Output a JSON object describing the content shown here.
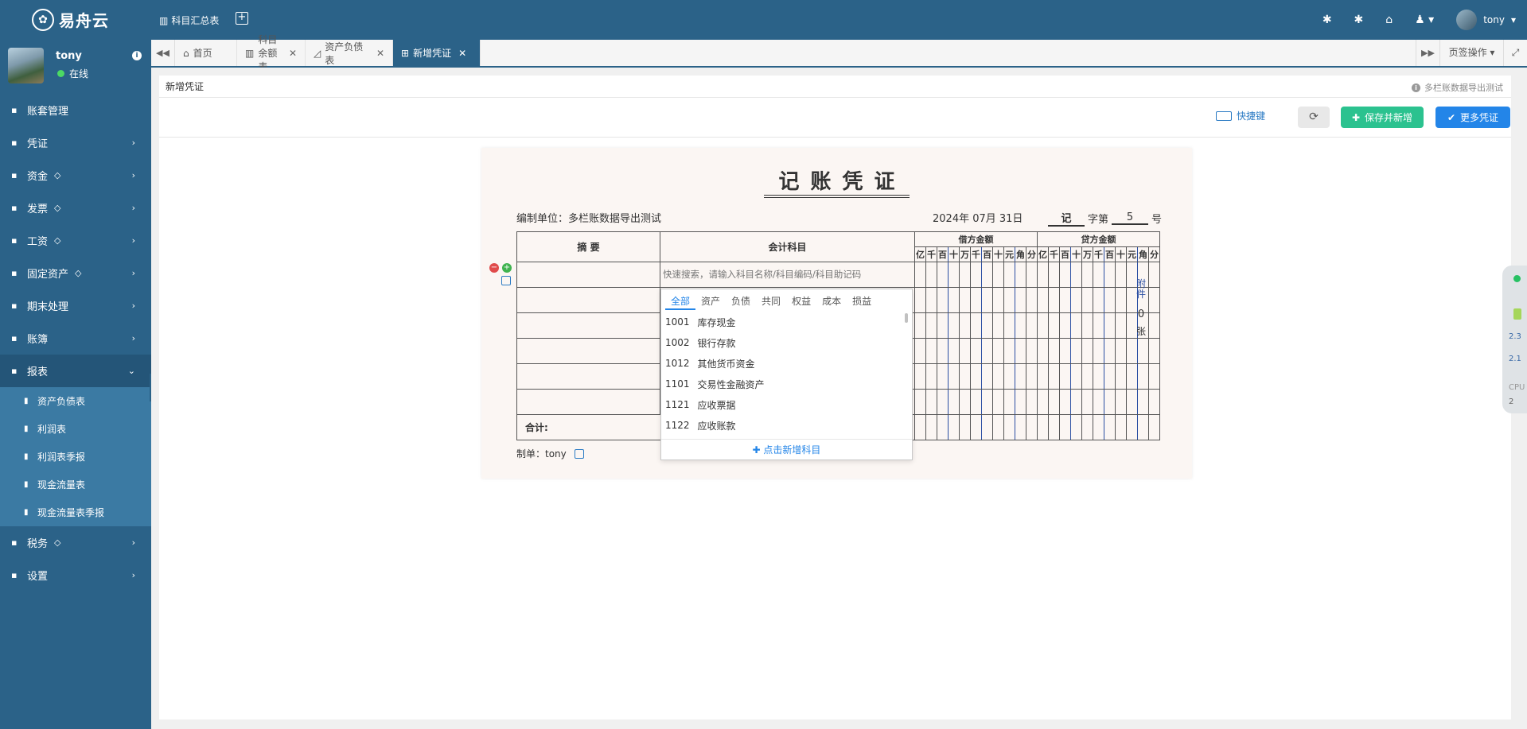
{
  "app": {
    "logo_text": "易舟云",
    "top_link": "科目汇总表",
    "user": "tony"
  },
  "profile": {
    "name": "tony",
    "status": "在线"
  },
  "sidebar": {
    "items": [
      {
        "label": "账套管理",
        "icon": "book-icon",
        "gem": false,
        "arrow": false
      },
      {
        "label": "凭证",
        "icon": "voucher-icon",
        "gem": false,
        "arrow": true
      },
      {
        "label": "资金",
        "icon": "money-icon",
        "gem": true,
        "arrow": true
      },
      {
        "label": "发票",
        "icon": "invoice-icon",
        "gem": true,
        "arrow": true
      },
      {
        "label": "工资",
        "icon": "salary-icon",
        "gem": true,
        "arrow": true
      },
      {
        "label": "固定资产",
        "icon": "asset-icon",
        "gem": true,
        "arrow": true
      },
      {
        "label": "期末处理",
        "icon": "calendar-icon",
        "gem": false,
        "arrow": true
      },
      {
        "label": "账簿",
        "icon": "ledger-icon",
        "gem": false,
        "arrow": true
      },
      {
        "label": "报表",
        "icon": "chart-icon",
        "gem": false,
        "arrow": true,
        "active": true
      },
      {
        "label": "税务",
        "icon": "tax-icon",
        "gem": true,
        "arrow": true
      },
      {
        "label": "设置",
        "icon": "gear-icon",
        "gem": false,
        "arrow": true
      }
    ],
    "report_subitems": [
      "资产负债表",
      "利润表",
      "利润表季报",
      "现金流量表",
      "现金流量表季报"
    ]
  },
  "tabs": [
    {
      "label": "首页",
      "closable": false
    },
    {
      "label": "科目余额表",
      "closable": true
    },
    {
      "label": "资产负债表",
      "closable": true
    },
    {
      "label": "新增凭证",
      "closable": true,
      "active": true
    }
  ],
  "tab_ops": "页签操作",
  "panel": {
    "title": "新增凭证",
    "right_note": "多栏账数据导出测试"
  },
  "toolbar": {
    "shortcut": "快捷键",
    "save_new": "保存并新增",
    "more": "更多凭证"
  },
  "voucher": {
    "title": "记账凭证",
    "unit_label": "编制单位：多栏账数据导出测试",
    "date": "2024年 07月 31日",
    "word": "记",
    "word_label": "字第",
    "number": "5",
    "number_suffix": "号",
    "col_summary": "摘 要",
    "col_subject": "会计科目",
    "col_debit": "借方金额",
    "col_credit": "贷方金额",
    "digits": [
      "亿",
      "千",
      "百",
      "十",
      "万",
      "千",
      "百",
      "十",
      "元",
      "角",
      "分"
    ],
    "search_placeholder": "快速搜索，请输入科目名称/科目编码/科目助记码",
    "total_label": "合计:",
    "attach_label": "附件",
    "attach_count": "0",
    "attach_unit": "张",
    "maker_label": "制单：tony"
  },
  "dropdown": {
    "tabs": [
      "全部",
      "资产",
      "负债",
      "共同",
      "权益",
      "成本",
      "损益"
    ],
    "items": [
      {
        "code": "1001",
        "name": "库存现金"
      },
      {
        "code": "1002",
        "name": "银行存款"
      },
      {
        "code": "1012",
        "name": "其他货币资金"
      },
      {
        "code": "1101",
        "name": "交易性金融资产"
      },
      {
        "code": "1121",
        "name": "应收票据"
      },
      {
        "code": "1122",
        "name": "应收账款"
      }
    ],
    "footer": "点击新增科目"
  },
  "widget": {
    "v1": "2.3",
    "v2": "2.1",
    "cpu": "CPU",
    "cpu_val": "2"
  },
  "colors": {
    "primary": "#2b6288",
    "save": "#2bc28f",
    "more": "#2385e8"
  }
}
